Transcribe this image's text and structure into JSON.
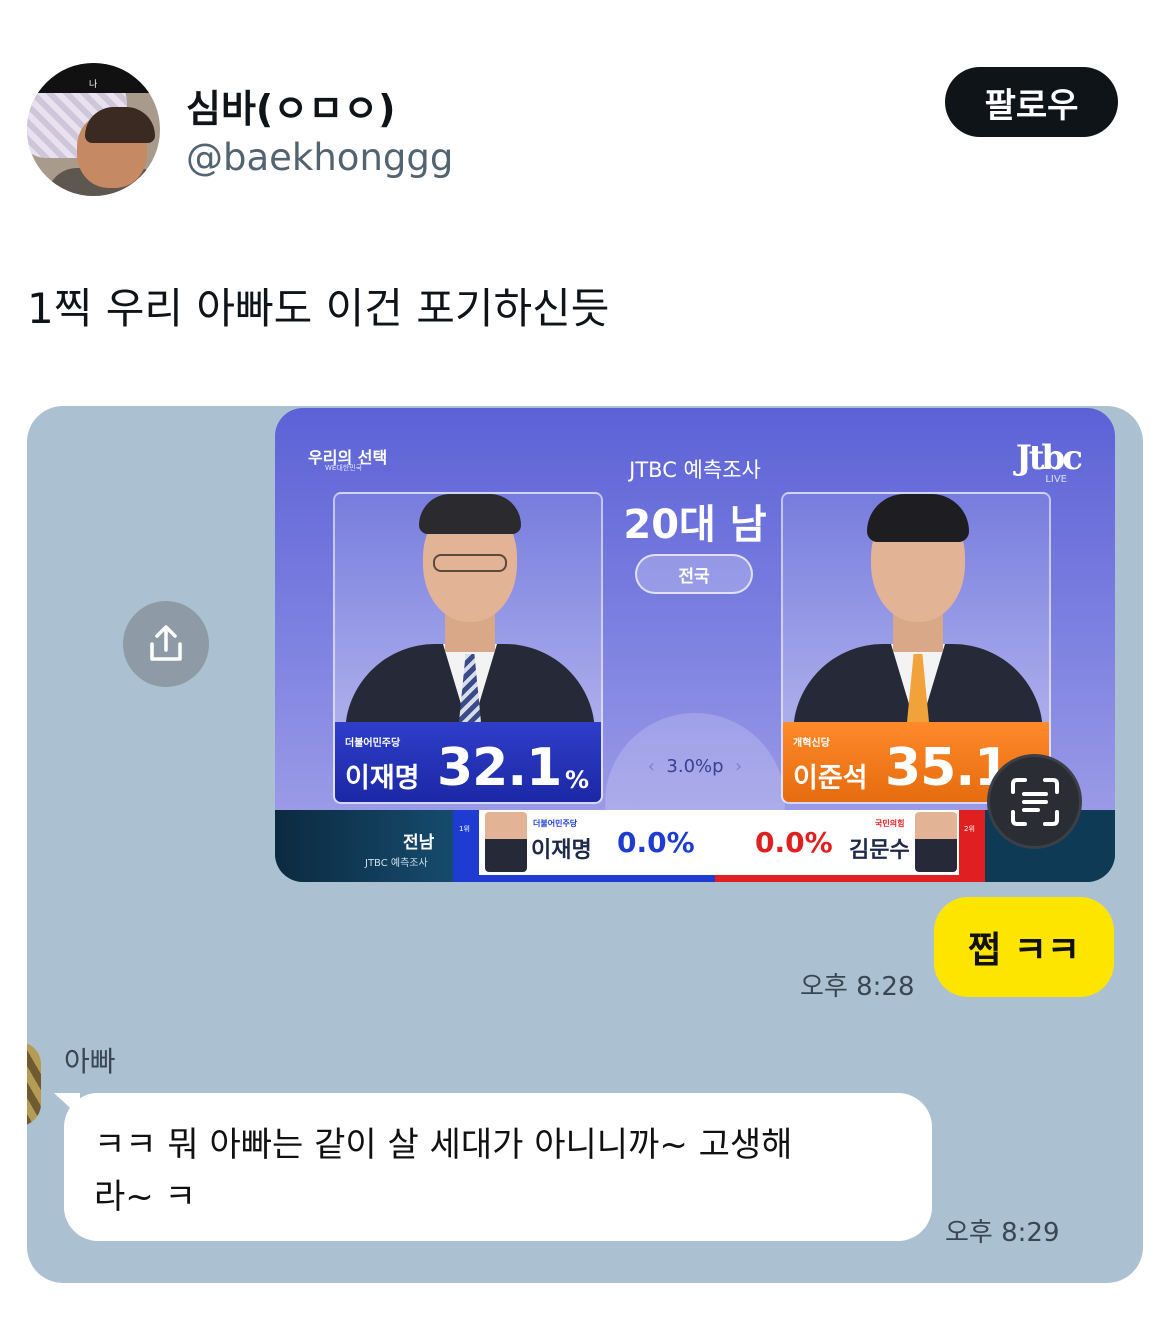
{
  "user": {
    "name": "심바(ㅇㅁㅇ)",
    "handle": "@baekhonggg",
    "avatar_tag": "나"
  },
  "follow_label": "팔로우",
  "tweet_text": "1찍 우리 아빠도 이건 포기하신듯",
  "broadcast": {
    "brand": "우리의 선택",
    "brand_sub": "WE대한민국",
    "network_logo": "Jtbc",
    "network_live": "LIVE",
    "poll_title": "JTBC 예측조사",
    "poll_group": "20대 남",
    "region_pill": "전국",
    "gap": "3.0%p",
    "gap_left_arrow": "‹",
    "gap_right_arrow": "›",
    "candidates": [
      {
        "party": "더불어민주당",
        "name": "이재명",
        "pct": "32.1",
        "unit": "%",
        "color": "#1f2fb8"
      },
      {
        "party": "개혁신당",
        "name": "이준석",
        "pct": "35.1",
        "unit": "",
        "color": "#f07a1a"
      }
    ],
    "ticker": {
      "region": "전남",
      "region_sub": "JTBC 예측조사",
      "left": {
        "rank": "1위",
        "party": "더불어민주당",
        "name": "이재명",
        "pct": "0.0%"
      },
      "right": {
        "rank": "2위",
        "party": "국민의힘",
        "name": "김문수",
        "pct": "0.0%"
      }
    }
  },
  "chat": {
    "my_message": "쩝 ㅋㅋ",
    "my_time": "오후 8:28",
    "sender_name": "아빠",
    "dad_message_line1": "ㅋㅋ 뭐 아빠는 같이 살 세대가 아니니까~ 고생해",
    "dad_message_line2": "라~ ㅋ",
    "dad_time": "오후 8:29"
  },
  "icons": {
    "share": "share-icon",
    "scan": "scan-text-icon"
  },
  "colors": {
    "follow_bg": "#0f1419",
    "chat_bg": "#abc1d1",
    "my_bubble": "#fee500",
    "dad_bubble": "#ffffff"
  }
}
